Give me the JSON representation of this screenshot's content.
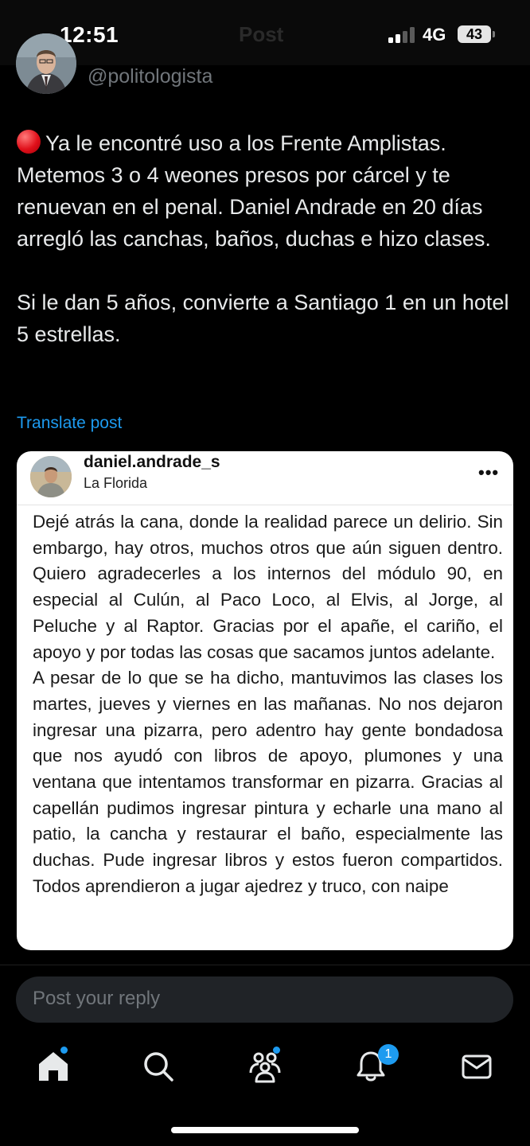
{
  "status_bar": {
    "time": "12:51",
    "ghost_title": "Post",
    "network": "4G",
    "battery": "43"
  },
  "post": {
    "author_handle": "@politologista",
    "text_line1": "Ya le encontré uso a los Frente Amplistas. Metemos 3 o 4 weones presos por cárcel y te renuevan en el penal. Daniel Andrade en 20 días arregló las canchas, baños, duchas e hizo clases.",
    "text_line2": "Si le dan 5 años, convierte a Santiago 1  en un hotel 5 estrellas.",
    "translate_label": "Translate post"
  },
  "embedded_image": {
    "username": "daniel.andrade_s",
    "location": "La Florida",
    "more_label": "•••",
    "paragraph1": "Dejé atrás la cana, donde la realidad parece un delirio. Sin embargo, hay otros, muchos otros que aún siguen dentro. Quiero agradecerles a los internos del módulo 90, en especial al Culún, al Paco Loco, al Elvis, al Jorge, al Peluche y al Raptor. Gracias por el apañe, el cariño, el apoyo y por todas las cosas que sacamos juntos adelante.",
    "paragraph2": "A pesar de lo que se ha dicho, mantuvimos las clases los martes, jueves y viernes en las mañanas. No nos dejaron ingresar una pizarra, pero adentro hay gente bondadosa que nos ayudó con libros de apoyo, plumones y una ventana que intentamos transformar en pizarra. Gracias al capellán pudimos ingresar pintura y echarle una mano al patio, la cancha y restaurar el baño, especialmente las duchas. Pude ingresar libros y estos fueron compartidos. Todos aprendieron a jugar ajedrez y truco, con naipe"
  },
  "reply": {
    "placeholder": "Post your reply"
  },
  "nav": {
    "items": [
      {
        "icon": "home-icon",
        "dot": true
      },
      {
        "icon": "search-icon",
        "dot": false
      },
      {
        "icon": "communities-icon",
        "dot": true
      },
      {
        "icon": "notifications-icon",
        "badge": "1"
      },
      {
        "icon": "messages-icon",
        "dot": false
      }
    ],
    "notification_badge": "1"
  },
  "colors": {
    "background": "#000000",
    "text": "#e7e9ea",
    "muted": "#71767b",
    "accent": "#1d9bf0",
    "reply_bg": "#202327"
  }
}
